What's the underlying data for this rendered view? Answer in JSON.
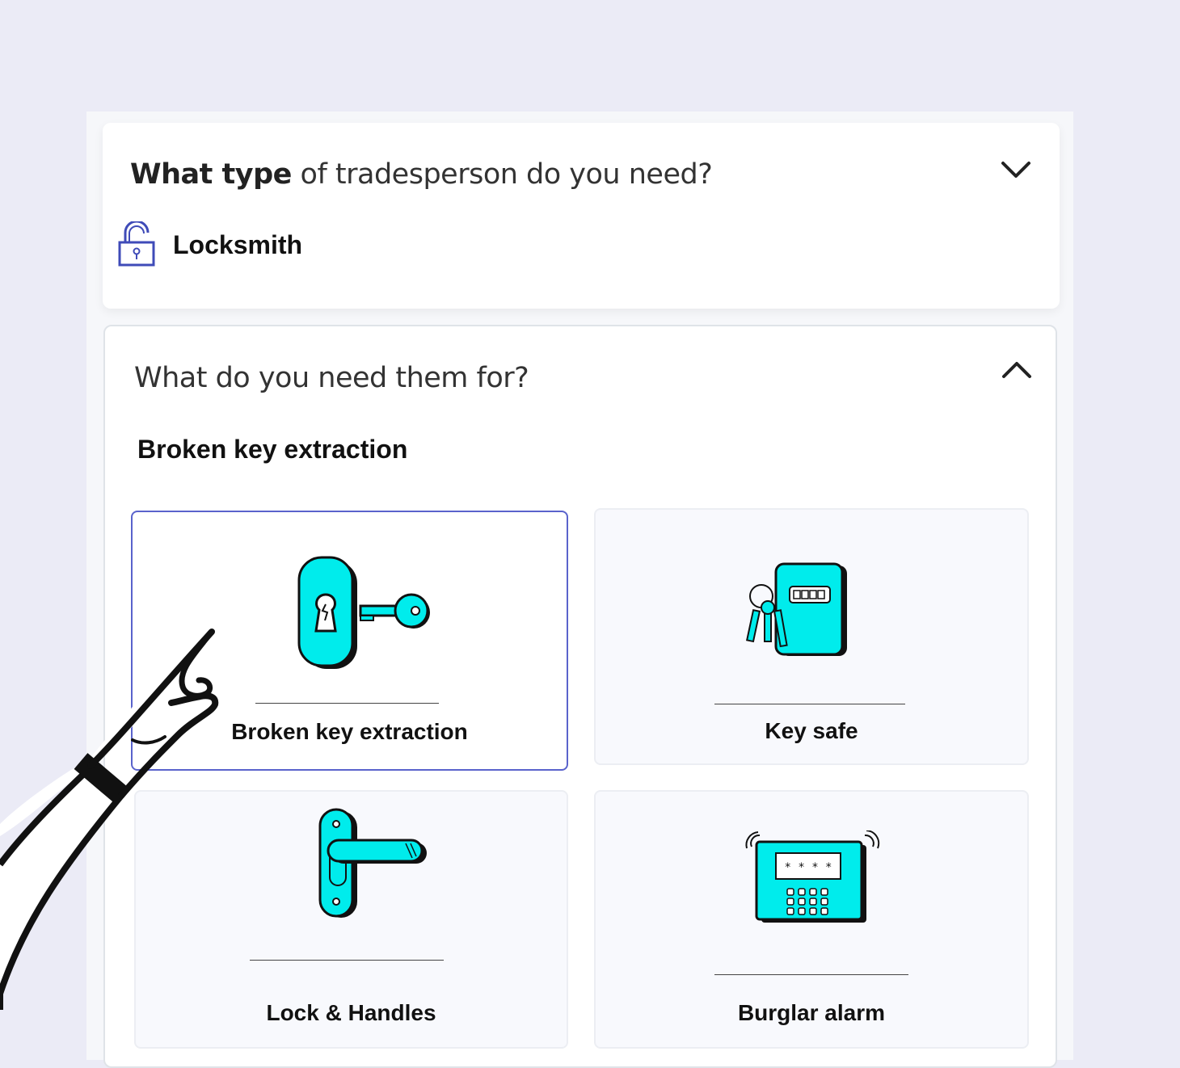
{
  "question1": {
    "title_bold": "What type",
    "title_rest": " of tradesperson do you need?",
    "selected": "Locksmith",
    "icon": "padlock-open-icon",
    "toggle_icon": "chevron-down-icon"
  },
  "question2": {
    "title": "What do you need them for?",
    "selected": "Broken key extraction",
    "toggle_icon": "chevron-up-icon",
    "options": [
      {
        "label": "Broken key extraction",
        "icon": "broken-key-icon",
        "selected": true
      },
      {
        "label": "Key safe",
        "icon": "key-safe-icon",
        "selected": false
      },
      {
        "label": "Lock & Handles",
        "icon": "door-handle-icon",
        "selected": false
      },
      {
        "label": "Burglar alarm",
        "icon": "burglar-alarm-icon",
        "selected": false
      }
    ]
  },
  "colors": {
    "background": "#ebebf6",
    "accent": "#00ecec",
    "selected_border": "#5a63cc",
    "icon_blue": "#3f4bb8"
  }
}
